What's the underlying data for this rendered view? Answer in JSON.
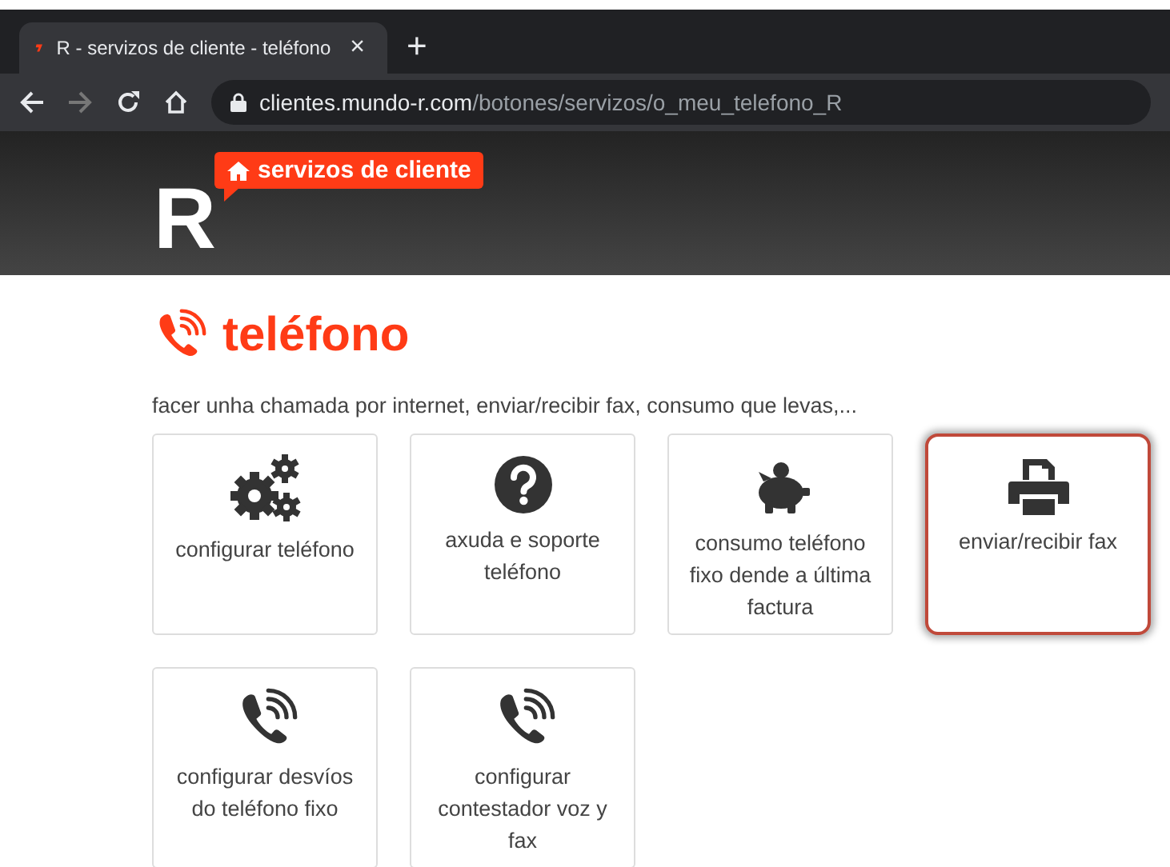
{
  "browser": {
    "tab": {
      "title": "R - servizos de cliente - teléfono",
      "close": "×"
    },
    "new_tab": "+",
    "url": {
      "host": "clientes.mundo-r.com",
      "path": "/botones/servizos/o_meu_telefono_R"
    }
  },
  "header": {
    "logo": "R",
    "badge": "servizos de cliente"
  },
  "page": {
    "title": "teléfono",
    "intro": "facer unha chamada por internet, enviar/recibir fax, consumo que levas,...",
    "tiles": [
      {
        "kind": "gears",
        "label": "configurar teléfono",
        "highlighted": false
      },
      {
        "kind": "question",
        "label": "axuda e soporte teléfono",
        "highlighted": false
      },
      {
        "kind": "piggy",
        "label": "consumo teléfono fixo dende a última factura",
        "highlighted": false
      },
      {
        "kind": "printer",
        "label": "enviar/recibir fax",
        "highlighted": true
      },
      {
        "kind": "phone",
        "label": "configurar desvíos do teléfono fixo",
        "highlighted": false
      },
      {
        "kind": "phone",
        "label": "configurar contestador voz y fax",
        "highlighted": false
      }
    ]
  }
}
